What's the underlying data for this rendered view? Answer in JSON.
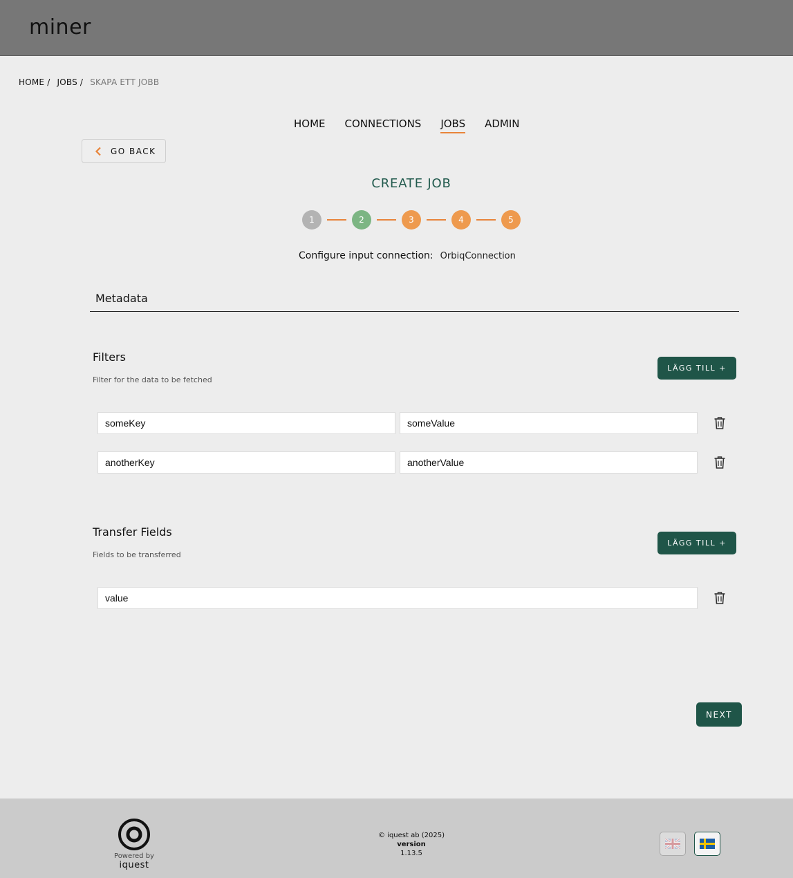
{
  "app": {
    "brand": "miner"
  },
  "breadcrumb": {
    "items": [
      "HOME",
      "JOBS"
    ],
    "separator": "/",
    "current": "SKAPA ETT JOBB"
  },
  "nav": {
    "tabs": [
      {
        "label": "HOME",
        "active": false
      },
      {
        "label": "CONNECTIONS",
        "active": false
      },
      {
        "label": "JOBS",
        "active": true
      },
      {
        "label": "ADMIN",
        "active": false
      }
    ]
  },
  "back_button": {
    "label": "GO BACK",
    "icon": "chevron-left-icon"
  },
  "page": {
    "title": "CREATE JOB"
  },
  "stepper": {
    "steps": [
      {
        "number": "1",
        "state": "done"
      },
      {
        "number": "2",
        "state": "current"
      },
      {
        "number": "3",
        "state": "pending"
      },
      {
        "number": "4",
        "state": "pending"
      },
      {
        "number": "5",
        "state": "pending"
      }
    ]
  },
  "config": {
    "label": "Configure input connection:",
    "value": "OrbiqConnection"
  },
  "metadata": {
    "label": "Metadata"
  },
  "filters": {
    "title": "Filters",
    "description": "Filter for the data to be fetched",
    "add_label": "LÄGG TILL +",
    "rows": [
      {
        "key": "someKey",
        "value": "someValue"
      },
      {
        "key": "anotherKey",
        "value": "anotherValue"
      }
    ]
  },
  "transfer": {
    "title": "Transfer Fields",
    "description": "Fields to be transferred",
    "add_label": "LÄGG TILL +",
    "rows": [
      {
        "value": "value"
      }
    ]
  },
  "next_button": {
    "label": "NEXT"
  },
  "footer": {
    "powered_by": "Powered by",
    "company": "iquest",
    "copyright": "© iquest ab (2025)",
    "version_label": "version",
    "version": "1.13.5",
    "languages": [
      "en-flag-icon",
      "sv-flag-icon"
    ]
  },
  "colors": {
    "header_bg": "#777777",
    "primary": "#1f5548",
    "accent": "#e8843a",
    "step_done": "#b3b3b3",
    "step_current": "#7cb583",
    "step_pending": "#ee9a4e"
  }
}
